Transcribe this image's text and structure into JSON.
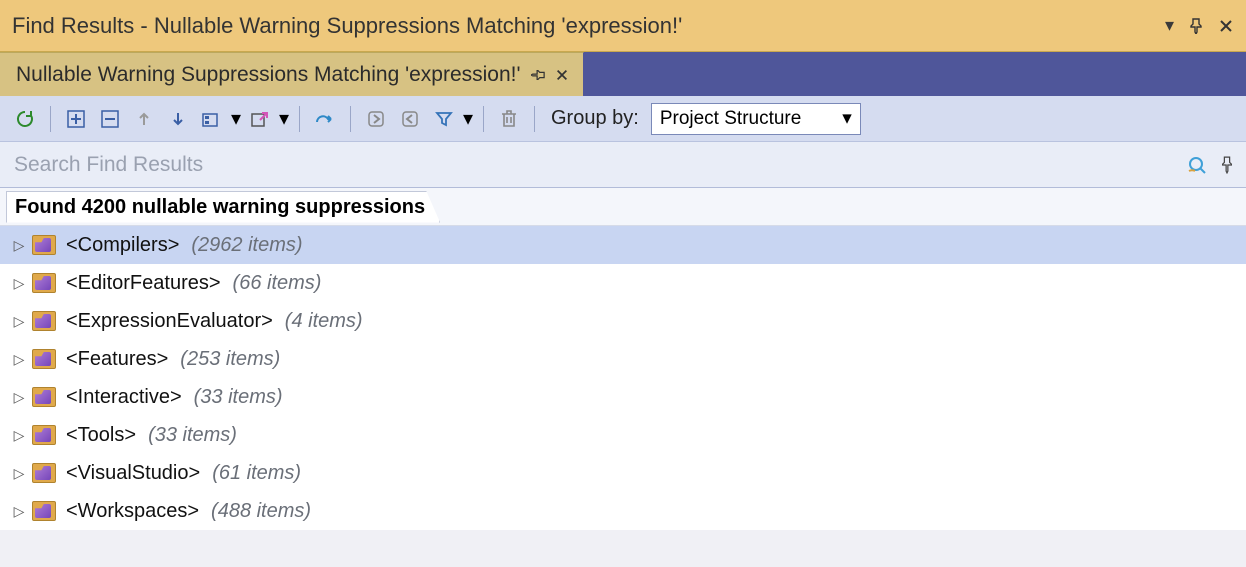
{
  "window": {
    "title": "Find Results - Nullable Warning Suppressions Matching 'expression!'"
  },
  "tab": {
    "label": "Nullable Warning Suppressions Matching 'expression!'"
  },
  "toolbar": {
    "group_by_label": "Group by:",
    "group_by_value": "Project Structure"
  },
  "search": {
    "placeholder": "Search Find Results"
  },
  "summary": {
    "text": "Found 4200 nullable warning suppressions"
  },
  "tree": {
    "items": [
      {
        "name": "<Compilers>",
        "count": "(2962 items)",
        "selected": true
      },
      {
        "name": "<EditorFeatures>",
        "count": "(66 items)",
        "selected": false
      },
      {
        "name": "<ExpressionEvaluator>",
        "count": "(4 items)",
        "selected": false
      },
      {
        "name": "<Features>",
        "count": "(253 items)",
        "selected": false
      },
      {
        "name": "<Interactive>",
        "count": "(33 items)",
        "selected": false
      },
      {
        "name": "<Tools>",
        "count": "(33 items)",
        "selected": false
      },
      {
        "name": "<VisualStudio>",
        "count": "(61 items)",
        "selected": false
      },
      {
        "name": "<Workspaces>",
        "count": "(488 items)",
        "selected": false
      }
    ]
  }
}
